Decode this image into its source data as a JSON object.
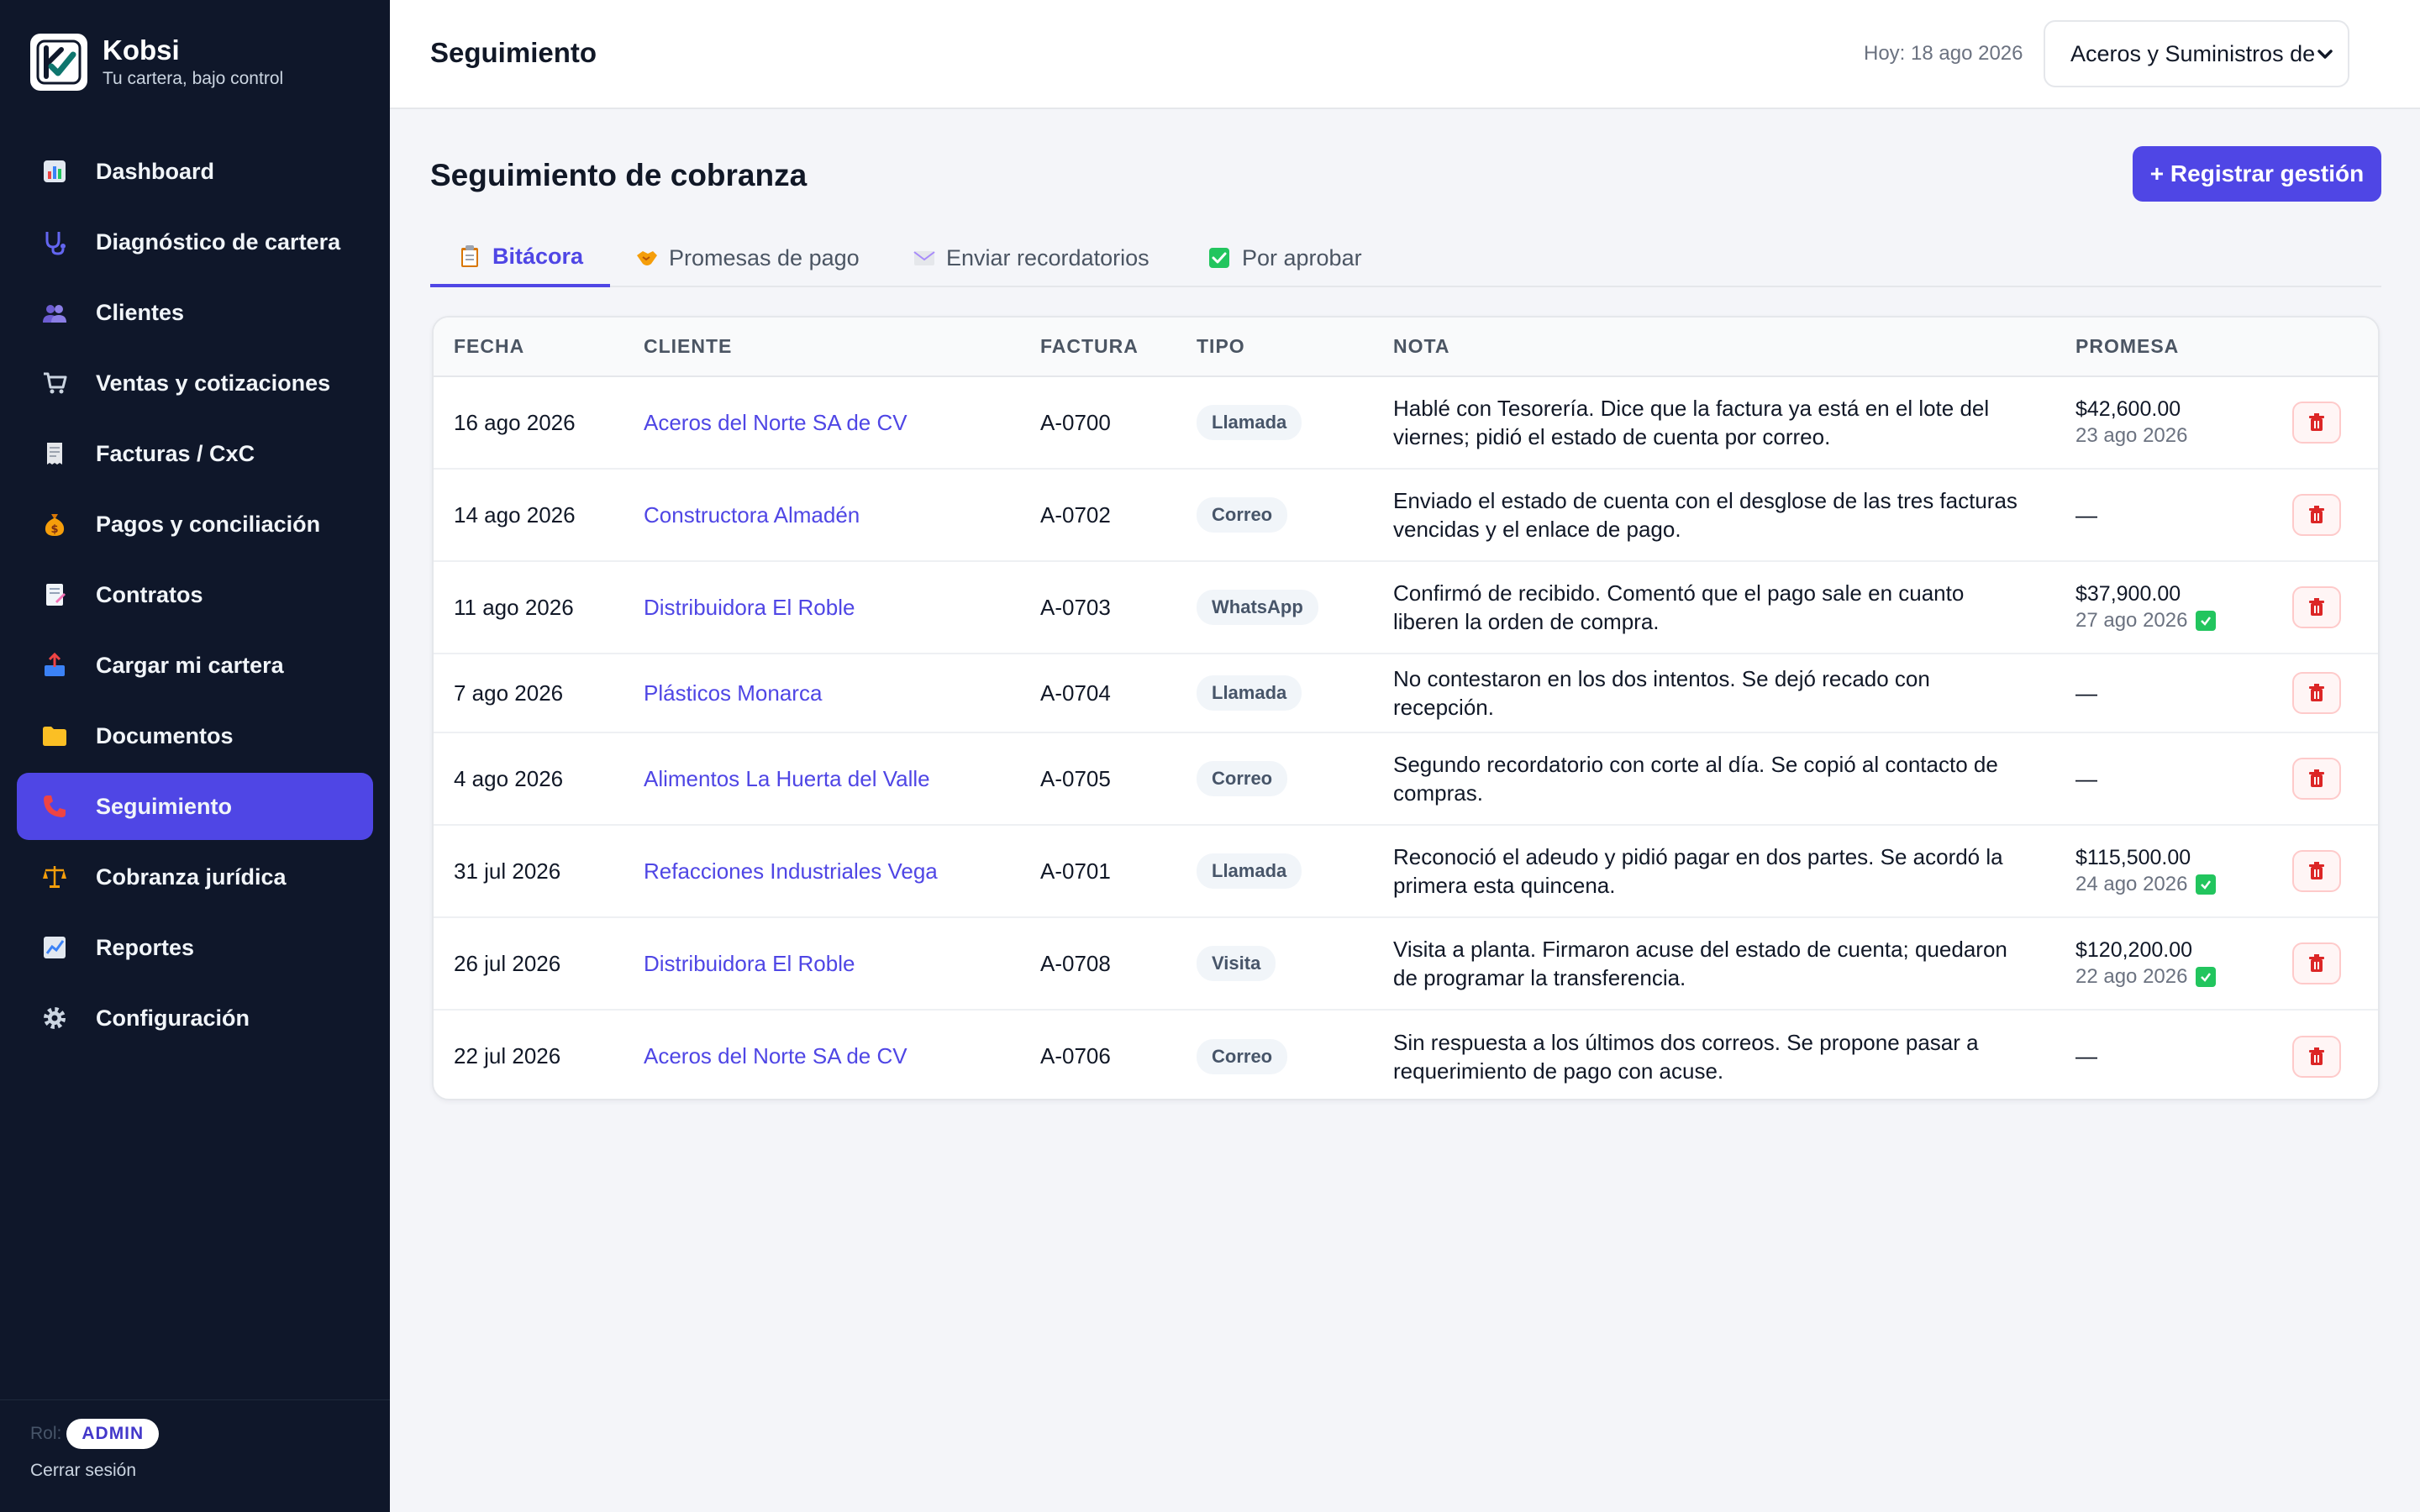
{
  "app": {
    "name": "Kobsi",
    "tagline": "Tu cartera, bajo control"
  },
  "sidebar": {
    "items": [
      {
        "label": "Dashboard",
        "icon": "bar-chart-icon",
        "active": false
      },
      {
        "label": "Diagnóstico de cartera",
        "icon": "stethoscope-icon",
        "active": false
      },
      {
        "label": "Clientes",
        "icon": "users-icon",
        "active": false
      },
      {
        "label": "Ventas y cotizaciones",
        "icon": "cart-icon",
        "active": false
      },
      {
        "label": "Facturas / CxC",
        "icon": "receipt-icon",
        "active": false
      },
      {
        "label": "Pagos y conciliación",
        "icon": "money-bag-icon",
        "active": false
      },
      {
        "label": "Contratos",
        "icon": "contract-icon",
        "active": false
      },
      {
        "label": "Cargar mi cartera",
        "icon": "upload-icon",
        "active": false
      },
      {
        "label": "Documentos",
        "icon": "folder-icon",
        "active": false
      },
      {
        "label": "Seguimiento",
        "icon": "phone-icon",
        "active": true
      },
      {
        "label": "Cobranza jurídica",
        "icon": "scales-icon",
        "active": false
      },
      {
        "label": "Reportes",
        "icon": "trend-icon",
        "active": false
      },
      {
        "label": "Configuración",
        "icon": "gear-icon",
        "active": false
      }
    ],
    "role_label": "Rol:",
    "role": "ADMIN",
    "logout": "Cerrar sesión"
  },
  "topbar": {
    "title": "Seguimiento",
    "today": "Hoy: 18 ago 2026",
    "company": "Aceros y Suministros del Bajío"
  },
  "main": {
    "title": "Seguimiento de cobranza",
    "primary_button": "+ Registrar gestión",
    "tabs": [
      {
        "label": "Bitácora",
        "icon": "clipboard-icon",
        "active": true
      },
      {
        "label": "Promesas de pago",
        "icon": "handshake-icon",
        "active": false
      },
      {
        "label": "Enviar recordatorios",
        "icon": "envelope-icon",
        "active": false
      },
      {
        "label": "Por aprobar",
        "icon": "checkbox-icon",
        "active": false
      }
    ]
  },
  "table": {
    "headers": [
      "FECHA",
      "CLIENTE",
      "FACTURA",
      "TIPO",
      "NOTA",
      "PROMESA"
    ],
    "rows": [
      {
        "fecha": "16 ago 2026",
        "cliente": "Aceros del Norte SA de CV",
        "factura": "A-0700",
        "tipo": "Llamada",
        "nota": "Hablé con Tesorería. Dice que la factura ya está en el lote del viernes; pidió el estado de cuenta por correo.",
        "promesa_monto": "$42,600.00",
        "promesa_fecha": "23 ago 2026",
        "cumplida": false
      },
      {
        "fecha": "14 ago 2026",
        "cliente": "Constructora Almadén",
        "factura": "A-0702",
        "tipo": "Correo",
        "nota": "Enviado el estado de cuenta con el desglose de las tres facturas vencidas y el enlace de pago.",
        "promesa_monto": "—",
        "promesa_fecha": "",
        "cumplida": false
      },
      {
        "fecha": "11 ago 2026",
        "cliente": "Distribuidora El Roble",
        "factura": "A-0703",
        "tipo": "WhatsApp",
        "nota": "Confirmó de recibido. Comentó que el pago sale en cuanto liberen la orden de compra.",
        "promesa_monto": "$37,900.00",
        "promesa_fecha": "27 ago 2026",
        "cumplida": true
      },
      {
        "fecha": "7 ago 2026",
        "cliente": "Plásticos Monarca",
        "factura": "A-0704",
        "tipo": "Llamada",
        "nota": "No contestaron en los dos intentos. Se dejó recado con recepción.",
        "promesa_monto": "—",
        "promesa_fecha": "",
        "cumplida": false
      },
      {
        "fecha": "4 ago 2026",
        "cliente": "Alimentos La Huerta del Valle",
        "factura": "A-0705",
        "tipo": "Correo",
        "nota": "Segundo recordatorio con corte al día. Se copió al contacto de compras.",
        "promesa_monto": "—",
        "promesa_fecha": "",
        "cumplida": false
      },
      {
        "fecha": "31 jul 2026",
        "cliente": "Refacciones Industriales Vega",
        "factura": "A-0701",
        "tipo": "Llamada",
        "nota": "Reconoció el adeudo y pidió pagar en dos partes. Se acordó la primera esta quincena.",
        "promesa_monto": "$115,500.00",
        "promesa_fecha": "24 ago 2026",
        "cumplida": true
      },
      {
        "fecha": "26 jul 2026",
        "cliente": "Distribuidora El Roble",
        "factura": "A-0708",
        "tipo": "Visita",
        "nota": "Visita a planta. Firmaron acuse del estado de cuenta; quedaron de programar la transferencia.",
        "promesa_monto": "$120,200.00",
        "promesa_fecha": "22 ago 2026",
        "cumplida": true
      },
      {
        "fecha": "22 jul 2026",
        "cliente": "Aceros del Norte SA de CV",
        "factura": "A-0706",
        "tipo": "Correo",
        "nota": "Sin respuesta a los últimos dos correos. Se propone pasar a requerimiento de pago con acuse.",
        "promesa_monto": "—",
        "promesa_fecha": "",
        "cumplida": false
      }
    ]
  },
  "colors": {
    "accent": "#4f46e5",
    "sidebar_bg": "#0f172a",
    "delete": "#dc2626",
    "ok": "#22c55e"
  }
}
